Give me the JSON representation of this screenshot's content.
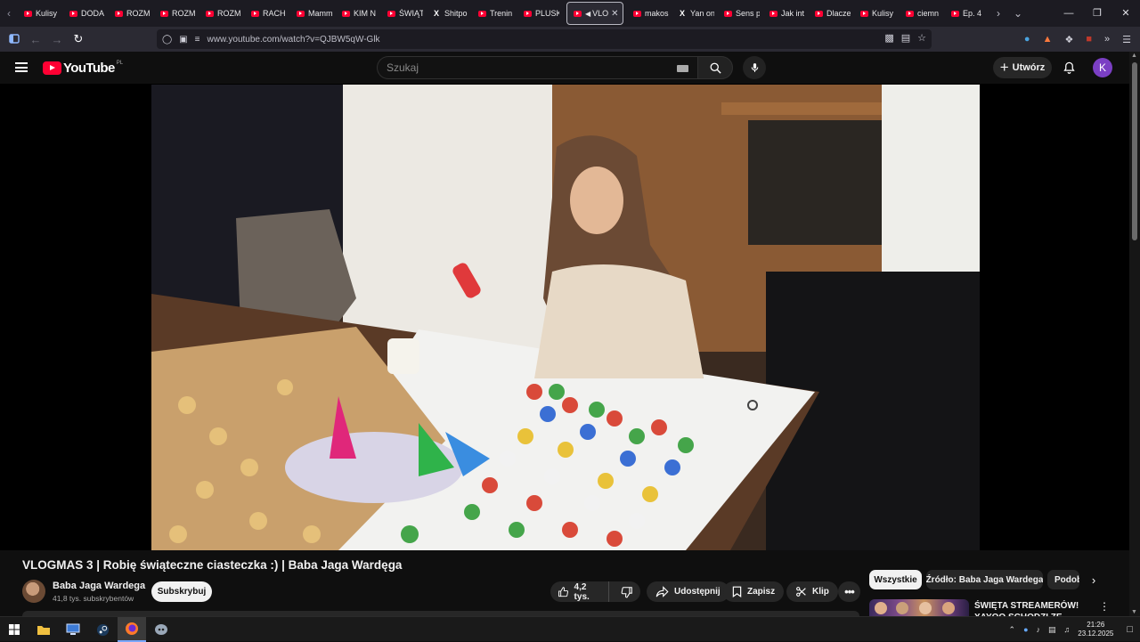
{
  "browser": {
    "tabs": [
      {
        "label": "Kulisy",
        "icon": "youtube-icon"
      },
      {
        "label": "DODA",
        "icon": "youtube-icon"
      },
      {
        "label": "ROZM",
        "icon": "youtube-icon"
      },
      {
        "label": "ROZM",
        "icon": "youtube-icon"
      },
      {
        "label": "ROZM",
        "icon": "youtube-icon"
      },
      {
        "label": "RACH",
        "icon": "youtube-icon"
      },
      {
        "label": "Mamm",
        "icon": "youtube-icon"
      },
      {
        "label": "KIM N",
        "icon": "youtube-icon"
      },
      {
        "label": "ŚWIĄT",
        "icon": "youtube-icon"
      },
      {
        "label": "Shitpo",
        "icon": "x-icon"
      },
      {
        "label": "Trenin",
        "icon": "youtube-icon"
      },
      {
        "label": "PLUSK",
        "icon": "youtube-icon"
      },
      {
        "label": "VLO",
        "icon": "youtube-icon",
        "active": true
      },
      {
        "label": "makos",
        "icon": "youtube-icon"
      },
      {
        "label": "Yan on",
        "icon": "x-icon"
      },
      {
        "label": "Sens p",
        "icon": "youtube-icon"
      },
      {
        "label": "Jak int",
        "icon": "youtube-icon"
      },
      {
        "label": "Dlacze",
        "icon": "youtube-icon"
      },
      {
        "label": "Kulisy",
        "icon": "youtube-icon"
      },
      {
        "label": "ciemn",
        "icon": "youtube-icon"
      },
      {
        "label": "Ep. 4",
        "icon": "youtube-icon"
      }
    ],
    "url": "www.youtube.com/watch?v=QJBW5qW-Glk"
  },
  "youtube": {
    "logo_text": "YouTube",
    "country_code": "PL",
    "search_placeholder": "Szukaj",
    "create_label": "Utwórz",
    "avatar_letter": "K",
    "avatar_color": "#7b3fc4"
  },
  "video": {
    "title": "VLOGMAS 3 | Robię świąteczne ciasteczka :) | Baba Jaga Wardęga",
    "channel_name": "Baba Jaga Wardega",
    "subscribers": "41,8 tys. subskrybentów",
    "subscribe_label": "Subskrybuj",
    "likes": "4,2 tys.",
    "share_label": "Udostępnij",
    "save_label": "Zapisz",
    "clip_label": "Klip"
  },
  "sidebar": {
    "chips": [
      "Wszystkie",
      "Źródło: Baba Jaga Wardega",
      "Podob"
    ],
    "recommendation_title": "ŚWIĘTA STREAMERÓW! XAYOO SCHODZI ZE SCENY!?"
  },
  "taskbar": {
    "time": "21:26",
    "date": "23.12.2025"
  },
  "colors": {
    "accent_red": "#ff0033",
    "background": "#0f0f0f",
    "chip_background": "#272727"
  }
}
